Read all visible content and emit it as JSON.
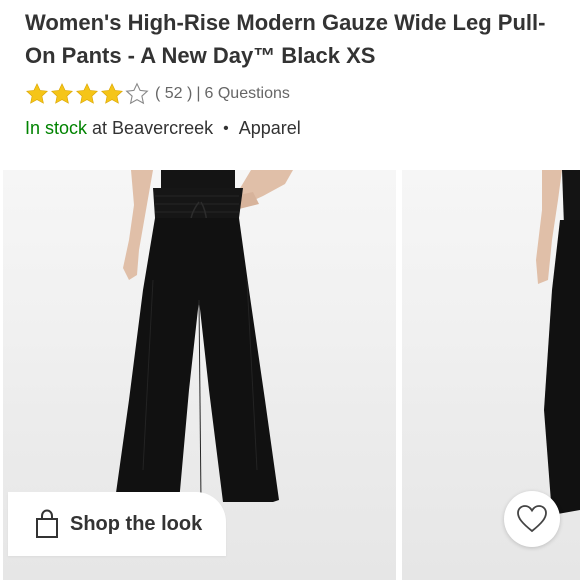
{
  "product": {
    "title": "Women's High-Rise Modern Gauze Wide Leg Pull-On Pants - A New Day™ Black XS"
  },
  "rating": {
    "stars_filled": 4,
    "stars_total": 5,
    "count_text": "( 52 )",
    "separator": "|",
    "questions_text": "6 Questions",
    "star_color": "#f5c518"
  },
  "availability": {
    "status": "In stock",
    "at_text": "at",
    "store": "Beavercreek",
    "bullet": "•",
    "department": "Apparel",
    "status_color": "#008300"
  },
  "gallery": {
    "images": [
      {
        "name": "main-product-photo",
        "icon": "model-wearing-pants"
      },
      {
        "name": "second-product-photo",
        "icon": "model-side-view"
      }
    ]
  },
  "actions": {
    "shop_the_look": {
      "label": "Shop the look",
      "icon": "shopping-bag-icon"
    },
    "favorite": {
      "icon": "heart-icon"
    }
  }
}
